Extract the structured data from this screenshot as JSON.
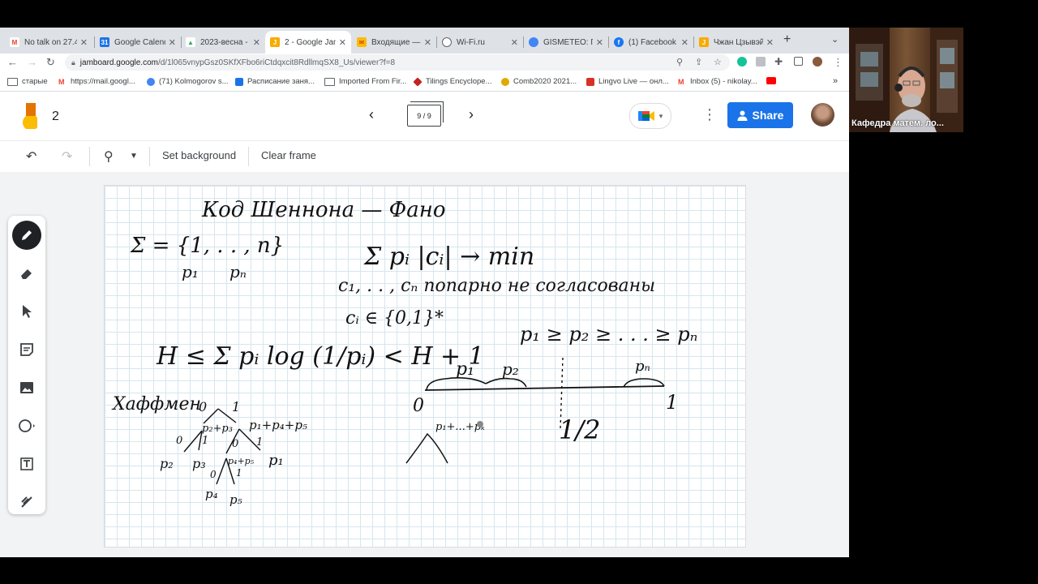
{
  "browser": {
    "tabs": [
      {
        "title": "No talk on 27.4",
        "icon": "gmail-icon",
        "color": "#ea4335",
        "glyph": "M"
      },
      {
        "title": "Google Calendar",
        "icon": "calendar-icon",
        "color": "#1a73e8",
        "glyph": "31"
      },
      {
        "title": "2023-весна -",
        "icon": "drive-icon",
        "color": "#34a853",
        "glyph": "▲"
      },
      {
        "title": "2 - Google Jam",
        "icon": "jamboard-icon",
        "color": "#f9ab00",
        "glyph": "J",
        "active": true
      },
      {
        "title": "Входящие —",
        "icon": "yandex-mail-icon",
        "color": "#fbbc04",
        "glyph": "✉"
      },
      {
        "title": "Wi-Fi.ru",
        "icon": "globe-icon",
        "color": "#5f6368",
        "glyph": "◎"
      },
      {
        "title": "GISMETEO: П",
        "icon": "gismeteo-icon",
        "color": "#4285f4",
        "glyph": "G"
      },
      {
        "title": "(1) Facebook",
        "icon": "facebook-icon",
        "color": "#1877f2",
        "glyph": "f"
      },
      {
        "title": "Чжан Цзывэй",
        "icon": "jamboard-icon",
        "color": "#f9ab00",
        "glyph": "J"
      }
    ],
    "url_host": "jamboard.google.com",
    "url_path": "/d/1l065vnypGsz0SKfXFbo6riCtdqxcit8RdllmqSX8_Us/viewer?f=8",
    "bookmarks": [
      {
        "label": "старые",
        "type": "folder"
      },
      {
        "label": "https://mail.googl...",
        "icon": "gmail-icon",
        "color": "#ea4335"
      },
      {
        "label": "(71) Kolmogorov s...",
        "icon": "people-icon",
        "color": "#4285f4"
      },
      {
        "label": "Расписание заня...",
        "icon": "schedule-icon",
        "color": "#1a73e8"
      },
      {
        "label": "Imported From Fir...",
        "type": "folder"
      },
      {
        "label": "Tilings Encyclope...",
        "icon": "tilings-icon",
        "color": "#c5221f"
      },
      {
        "label": "Comb2020 2021...",
        "icon": "comb-icon",
        "color": "#e0a800"
      },
      {
        "label": "Lingvo Live — онл...",
        "icon": "lingvo-icon",
        "color": "#d93025"
      },
      {
        "label": "Inbox (5) - nikolay...",
        "icon": "gmail-icon",
        "color": "#ea4335"
      }
    ]
  },
  "jamboard": {
    "doc_name": "2",
    "frame_indicator": "9 / 9",
    "share_label": "Share",
    "toolbar": {
      "set_background": "Set background",
      "clear_frame": "Clear frame"
    }
  },
  "whiteboard": {
    "title": "Код Шеннона — Фано",
    "alphabet": "Σ = {1, . . , n}",
    "probs_line": "p₁      pₙ",
    "objective": "Σ pᵢ |cᵢ| → min",
    "codewords": "c₁, . . , cₙ попарно не согласованы",
    "membership": "cᵢ ∈ {0,1}*",
    "ordering": "p₁ ≥ p₂ ≥ . . . ≥ pₙ",
    "entropy_bound": "H ≤ Σ pᵢ log (1/pᵢ) < H + 1",
    "huffman_label": "Хаффмен",
    "interval": {
      "left": "0",
      "right": "1",
      "half": "1/2",
      "p1": "p₁",
      "p2": "p₂",
      "pn": "pₙ"
    },
    "tree_labels": {
      "b0": "0",
      "b1": "1",
      "n1": "p₂+p₃",
      "n2": "p₁+p₄+p₅",
      "l1": "0",
      "l2": "1",
      "l3": "0",
      "l4": "1",
      "p2": "p₂",
      "p3": "p₃",
      "n3": "p₄+p₅",
      "p1": "p₁",
      "l5": "0",
      "l6": "1",
      "p4": "p₄",
      "p5": "p₅"
    },
    "partial_sum": "p₁+...+pₖ"
  },
  "video": {
    "participant_name": "Кафедра матем. ло..."
  }
}
